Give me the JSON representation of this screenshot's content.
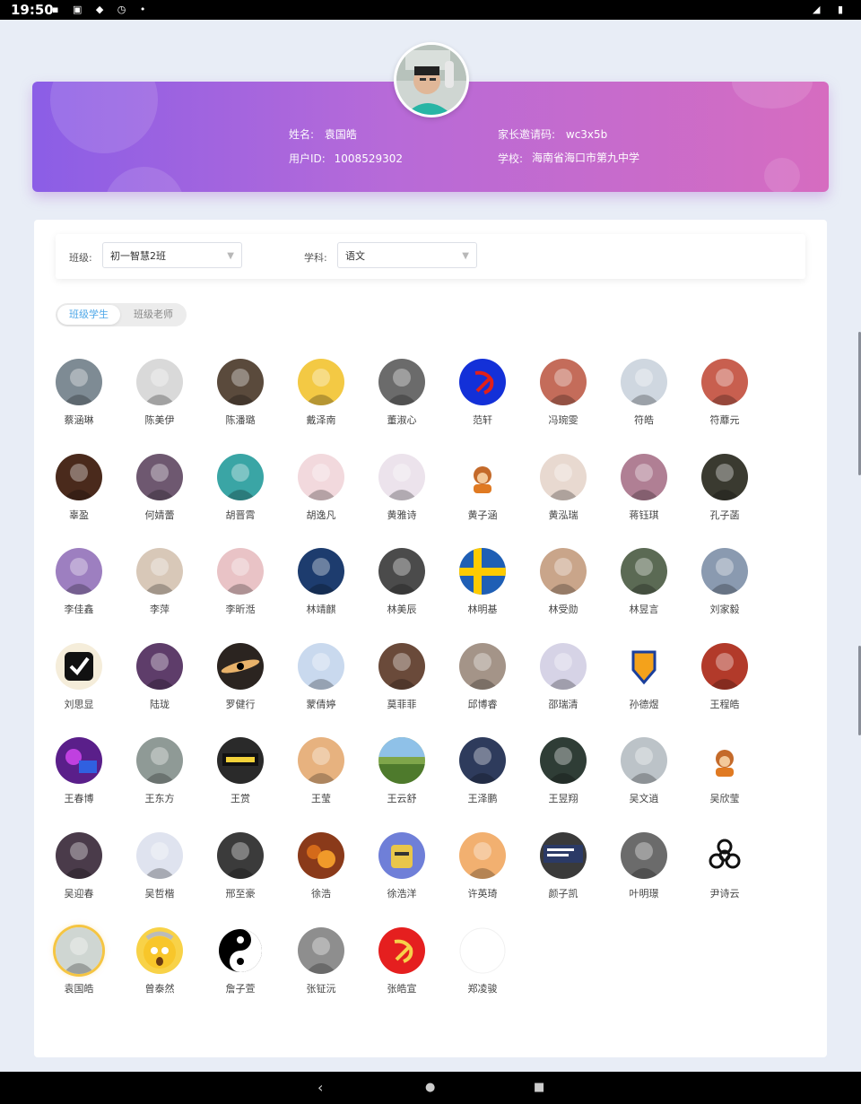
{
  "status": {
    "time": "19:50"
  },
  "profile": {
    "name_label": "姓名:",
    "name": "袁国皓",
    "uid_label": "用户ID:",
    "uid": "1008529302",
    "invite_label": "家长邀请码:",
    "invite_code": "wc3x5b",
    "school_label": "学校:",
    "school": "海南省海口市第九中学"
  },
  "filters": {
    "class_label": "班级:",
    "class_value": "初一智慧2班",
    "subject_label": "学科:",
    "subject_value": "语文"
  },
  "tabs": {
    "students": "班级学生",
    "teachers": "班级老师"
  },
  "students": [
    {
      "name": "蔡涵琳",
      "color": "#7e8b94",
      "icon": "photo-avatar"
    },
    {
      "name": "陈美伊",
      "color": "#d9d9d9",
      "icon": "sketch-avatar"
    },
    {
      "name": "陈潘璐",
      "color": "#5a4a3c",
      "icon": "photo-avatar"
    },
    {
      "name": "戴泽南",
      "color": "#f3c944",
      "icon": "anime-avatar"
    },
    {
      "name": "董淑心",
      "color": "#6b6b6b",
      "icon": "photo-avatar"
    },
    {
      "name": "范轩",
      "color": "#1330d8",
      "icon": "hammer-sickle-avatar"
    },
    {
      "name": "冯琬雯",
      "color": "#c46c5a",
      "icon": "doll-avatar"
    },
    {
      "name": "符皓",
      "color": "#cfd7e0",
      "icon": "photo-avatar"
    },
    {
      "name": "符蘼元",
      "color": "#c85f4f",
      "icon": "doll-avatar"
    },
    {
      "name": "辜盈",
      "color": "#4a2a1c",
      "icon": "photo-avatar"
    },
    {
      "name": "何婧蕾",
      "color": "#6e5870",
      "icon": "photo-avatar"
    },
    {
      "name": "胡晋霄",
      "color": "#3aa5a5",
      "icon": "photo-avatar"
    },
    {
      "name": "胡逸凡",
      "color": "#f2d9dd",
      "icon": "anime-avatar"
    },
    {
      "name": "黄雅诗",
      "color": "#ece3ec",
      "icon": "anime-avatar"
    },
    {
      "name": "黄子涵",
      "color": "#ffffff",
      "icon": "monkey-avatar"
    },
    {
      "name": "黄泓瑞",
      "color": "#e8d9d0",
      "icon": "anime-avatar"
    },
    {
      "name": "蒋钰琪",
      "color": "#b07f94",
      "icon": "anime-avatar"
    },
    {
      "name": "孔子菡",
      "color": "#3a3a30",
      "icon": "photo-avatar"
    },
    {
      "name": "李佳鑫",
      "color": "#9d7fc0",
      "icon": "anime-avatar"
    },
    {
      "name": "李萍",
      "color": "#d8c8b8",
      "icon": "photo-avatar"
    },
    {
      "name": "李昕湉",
      "color": "#e9c3c6",
      "icon": "anime-avatar"
    },
    {
      "name": "林靖麒",
      "color": "#1d3c6e",
      "icon": "photo-avatar"
    },
    {
      "name": "林美辰",
      "color": "#4b4b4b",
      "icon": "photo-avatar"
    },
    {
      "name": "林明基",
      "color": "#1f5fb5",
      "icon": "sweden-flag-avatar"
    },
    {
      "name": "林受勋",
      "color": "#c9a58a",
      "icon": "cartoon-avatar"
    },
    {
      "name": "林昱言",
      "color": "#5b6a54",
      "icon": "cartoon-avatar"
    },
    {
      "name": "刘家毅",
      "color": "#8a9ab0",
      "icon": "photo-avatar"
    },
    {
      "name": "刘思显",
      "color": "#f5edda",
      "icon": "checkmark-avatar"
    },
    {
      "name": "陆珑",
      "color": "#5e3d6a",
      "icon": "anime-avatar"
    },
    {
      "name": "罗健行",
      "color": "#2b2420",
      "icon": "galaxy-avatar"
    },
    {
      "name": "蒙倩婷",
      "color": "#c9d9ee",
      "icon": "anime-avatar"
    },
    {
      "name": "莫菲菲",
      "color": "#6a4a3a",
      "icon": "photo-avatar"
    },
    {
      "name": "邱博睿",
      "color": "#a49488",
      "icon": "photo-avatar"
    },
    {
      "name": "邵瑞清",
      "color": "#d6d3e6",
      "icon": "anime-avatar"
    },
    {
      "name": "孙德煜",
      "color": "#ffffff",
      "icon": "koenigsegg-avatar"
    },
    {
      "name": "王程皓",
      "color": "#b23a2a",
      "icon": "photo-avatar"
    },
    {
      "name": "王春博",
      "color": "#5a1f8a",
      "icon": "game-avatar"
    },
    {
      "name": "王东方",
      "color": "#8f9a96",
      "icon": "anime-avatar"
    },
    {
      "name": "王赏",
      "color": "#2a2a2a",
      "icon": "sign-avatar"
    },
    {
      "name": "王莹",
      "color": "#e7b27f",
      "icon": "anime-avatar"
    },
    {
      "name": "王云舒",
      "color": "#7fa64a",
      "icon": "landscape-avatar"
    },
    {
      "name": "王泽鹏",
      "color": "#2e3b5c",
      "icon": "photo-avatar"
    },
    {
      "name": "王昱翔",
      "color": "#2f3d36",
      "icon": "photo-avatar"
    },
    {
      "name": "吴文逍",
      "color": "#bcc3c8",
      "icon": "anime-avatar"
    },
    {
      "name": "吴欣莹",
      "color": "#ffffff",
      "icon": "monkey-avatar"
    },
    {
      "name": "吴迎春",
      "color": "#4a3b4a",
      "icon": "anime-avatar"
    },
    {
      "name": "吴哲楷",
      "color": "#dfe3ef",
      "icon": "anime-avatar"
    },
    {
      "name": "邢至豪",
      "color": "#3b3b3b",
      "icon": "anime-avatar"
    },
    {
      "name": "徐浩",
      "color": "#8a3a1a",
      "icon": "fire-avatar"
    },
    {
      "name": "徐浩洋",
      "color": "#6f7fd8",
      "icon": "robot-avatar"
    },
    {
      "name": "许英琦",
      "color": "#f2b070",
      "icon": "cartoon-avatar"
    },
    {
      "name": "颜子凯",
      "color": "#3a3a3a",
      "icon": "screenshot-avatar"
    },
    {
      "name": "叶明璟",
      "color": "#6b6b6b",
      "icon": "photo-avatar"
    },
    {
      "name": "尹诗云",
      "color": "#ffffff",
      "icon": "biohazard-avatar"
    },
    {
      "name": "袁国皓",
      "color": "#cfd6d2",
      "icon": "photo-avatar",
      "selected": true
    },
    {
      "name": "曾泰然",
      "color": "#f8d248",
      "icon": "emoji-avatar"
    },
    {
      "name": "詹子萱",
      "color": "#ffffff",
      "icon": "yin-yang-avatar"
    },
    {
      "name": "张钲沅",
      "color": "#8e8e8e",
      "icon": "photo-avatar"
    },
    {
      "name": "张皓宣",
      "color": "#e51f1f",
      "icon": "hammer-sickle-avatar"
    },
    {
      "name": "郑凌骏",
      "color": "#ffffff",
      "icon": "blank-avatar"
    }
  ]
}
